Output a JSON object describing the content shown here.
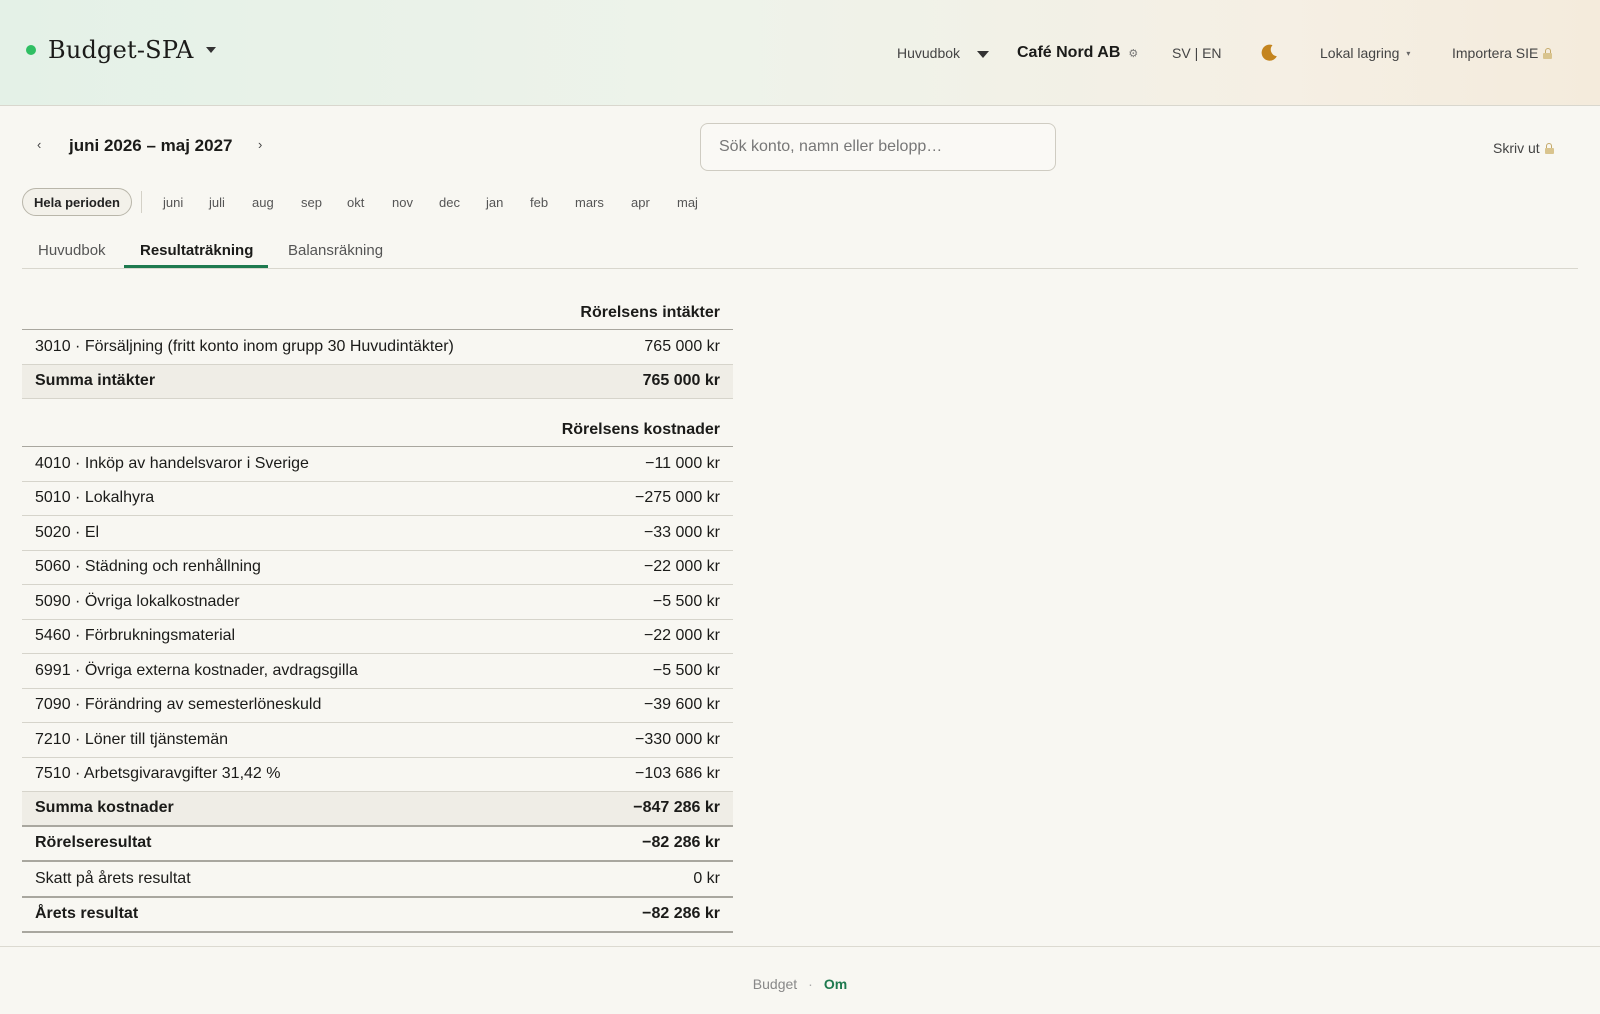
{
  "header": {
    "app_name": "Budget-SPA",
    "ledger_menu": "Huvudbok",
    "company": "Café Nord AB",
    "company_icon": "gear-icon",
    "language": "SV | EN",
    "theme_icon": "moon-icon",
    "storage": "Lokal lagring",
    "import": "Importera SIE",
    "brand_dot_color": "#2fbf63",
    "theme_color": "#c4841e"
  },
  "toolbar": {
    "prev_label": "‹",
    "next_label": "›",
    "period": "juni 2026 – maj 2027",
    "search_placeholder": "Sök konto, namn eller belopp…",
    "print": "Skriv ut"
  },
  "filter": {
    "all_label": "Hela perioden",
    "months": [
      "juni",
      "juli",
      "aug",
      "sep",
      "okt",
      "nov",
      "dec",
      "jan",
      "feb",
      "mars",
      "apr",
      "maj"
    ]
  },
  "tabs": [
    {
      "label": "Huvudbok",
      "active": false
    },
    {
      "label": "Resultaträkning",
      "active": true
    },
    {
      "label": "Balansräkning",
      "active": false
    }
  ],
  "report": {
    "income_heading": "Rörelsens intäkter",
    "income_rows": [
      {
        "account": "3010 · Försäljning (fritt konto inom grupp 30 Huvudintäkter)",
        "amount": "765 000 kr"
      }
    ],
    "income_total": {
      "label": "Summa intäkter",
      "amount": "765 000 kr"
    },
    "cost_heading": "Rörelsens kostnader",
    "cost_rows": [
      {
        "account": "4010 · Inköp av handelsvaror i Sverige",
        "amount": "−11 000 kr"
      },
      {
        "account": "5010 · Lokalhyra",
        "amount": "−275 000 kr"
      },
      {
        "account": "5020 · El",
        "amount": "−33 000 kr"
      },
      {
        "account": "5060 · Städning och renhållning",
        "amount": "−22 000 kr"
      },
      {
        "account": "5090 · Övriga lokalkostnader",
        "amount": "−5 500 kr"
      },
      {
        "account": "5460 · Förbrukningsmaterial",
        "amount": "−22 000 kr"
      },
      {
        "account": "6991 · Övriga externa kostnader, avdragsgilla",
        "amount": "−5 500 kr"
      },
      {
        "account": "7090 · Förändring av semesterlöneskuld",
        "amount": "−39 600 kr"
      },
      {
        "account": "7210 · Löner till tjänstemän",
        "amount": "−330 000 kr"
      },
      {
        "account": "7510 · Arbetsgivaravgifter 31,42 %",
        "amount": "−103 686 kr"
      }
    ],
    "cost_total": {
      "label": "Summa kostnader",
      "amount": "−847 286 kr"
    },
    "operating_result": {
      "label": "Rörelseresultat",
      "amount": "−82 286 kr"
    },
    "tax": {
      "label": "Skatt på årets resultat",
      "amount": "0 kr"
    },
    "year_result": {
      "label": "Årets resultat",
      "amount": "−82 286 kr"
    }
  },
  "footer": {
    "budget": "Budget",
    "separator": "·",
    "about": "Om",
    "accent_color": "#1e7a4f"
  }
}
